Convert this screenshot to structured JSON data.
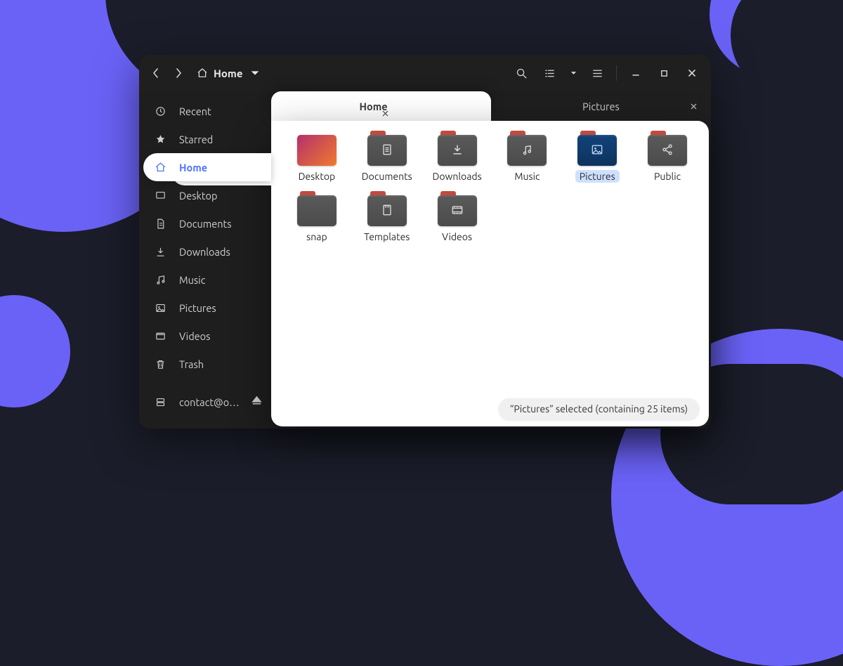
{
  "location": {
    "label": "Home"
  },
  "tabs": [
    {
      "label": "Home",
      "active": true
    },
    {
      "label": "Pictures",
      "active": false
    }
  ],
  "sidebar": {
    "items": [
      {
        "icon": "clock",
        "label": "Recent"
      },
      {
        "icon": "star",
        "label": "Starred"
      },
      {
        "icon": "home",
        "label": "Home",
        "active": true
      },
      {
        "icon": "desktop",
        "label": "Desktop"
      },
      {
        "icon": "document",
        "label": "Documents"
      },
      {
        "icon": "download",
        "label": "Downloads"
      },
      {
        "icon": "music",
        "label": "Music"
      },
      {
        "icon": "picture",
        "label": "Pictures"
      },
      {
        "icon": "video",
        "label": "Videos"
      },
      {
        "icon": "trash",
        "label": "Trash"
      }
    ],
    "mount": {
      "label": "contact@o…"
    }
  },
  "files": [
    {
      "name": "Desktop",
      "type": "desktop"
    },
    {
      "name": "Documents",
      "type": "folder",
      "glyph": "doc"
    },
    {
      "name": "Downloads",
      "type": "folder",
      "glyph": "down"
    },
    {
      "name": "Music",
      "type": "folder",
      "glyph": "music"
    },
    {
      "name": "Pictures",
      "type": "folder",
      "glyph": "pic",
      "selected": true
    },
    {
      "name": "Public",
      "type": "folder",
      "glyph": "share"
    },
    {
      "name": "snap",
      "type": "folder"
    },
    {
      "name": "Templates",
      "type": "folder",
      "glyph": "tmpl"
    },
    {
      "name": "Videos",
      "type": "folder",
      "glyph": "vid"
    }
  ],
  "status": {
    "text": "“Pictures” selected  (containing 25 items)"
  }
}
